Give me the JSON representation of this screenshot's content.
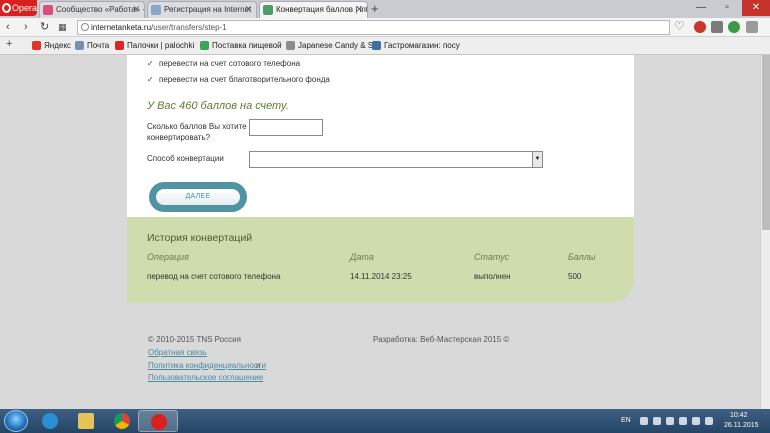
{
  "browser": {
    "menu_label": "Opera",
    "tabs": [
      {
        "title": "Сообщество «Работа» · ",
        "active": false,
        "color": "#d94f7a"
      },
      {
        "title": "Регистрация на Internet",
        "active": false,
        "color": "#8aa6c8"
      },
      {
        "title": "Конвертация баллов | int",
        "active": true,
        "color": "#4d9d6a"
      }
    ],
    "new_tab": "+",
    "url_host": "internetanketa.ru",
    "url_path": "/user/transfers/step-1",
    "bookmarks": [
      {
        "label": "Яндекс",
        "color": "#e0332b"
      },
      {
        "label": "Почта",
        "color": "#7a8fb0"
      },
      {
        "label": "Палочки | palochki",
        "color": "#d9262b"
      },
      {
        "label": "Поставка пищевой",
        "color": "#3aa65a"
      },
      {
        "label": "Japanese Candy & Sn",
        "color": "#8c8c8c"
      },
      {
        "label": "Гастромагазин: посу",
        "color": "#3f6ea8"
      }
    ]
  },
  "page": {
    "options": [
      "перевести на счет сотового телефона",
      "перевести на счет благотворительного фонда"
    ],
    "balance_text": "У Вас 460 баллов на счету.",
    "amount_label_line1": "Сколько баллов Вы хотите",
    "amount_label_line2": "конвертировать?",
    "method_label": "Способ конвертации",
    "next_button": "ДАЛЕЕ",
    "history": {
      "title": "История конвертаций",
      "columns": [
        "Операция",
        "Дата",
        "Статус",
        "Баллы"
      ],
      "rows": [
        [
          "перевод на счет сотового телефона",
          "14.11.2014 23:25",
          "выполнен",
          "500"
        ]
      ]
    },
    "footer": {
      "copyright": "© 2010-2015 TNS Россия",
      "dev": "Разработка: Веб-Мастерская 2015 ©",
      "links": [
        "Обратная связь",
        "Политика конфиденциальности",
        "Пользовательское соглашение"
      ],
      "and_text": "и"
    }
  },
  "taskbar": {
    "lang": "EN",
    "time": "10:42",
    "date": "26.11.2015"
  },
  "colors": {
    "accent_green": "#5b7a33",
    "history_bg": "#cfdcae",
    "button_teal": "#4f94a3",
    "link": "#4b8aa3"
  }
}
